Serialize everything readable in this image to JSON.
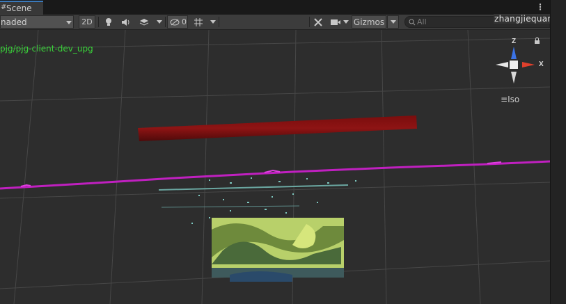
{
  "tab": {
    "label": "Scene",
    "icon": "scene-icon"
  },
  "toolbar": {
    "shading_mode": "naded",
    "mode_2d": "2D",
    "hidden_count": "0",
    "gizmos_label": "Gizmos",
    "search_placeholder": "All"
  },
  "user": {
    "name": "zhangjiequan"
  },
  "scene": {
    "overlay_path": "pjg/pjg-client-dev_upg",
    "projection_label": "Iso",
    "gizmo_axes": {
      "z": "Z",
      "x": "X"
    }
  },
  "colors": {
    "accent": "#3a79bb",
    "path_text": "#39d339",
    "gizmo_x": "#e0402c",
    "gizmo_z": "#3b73e6"
  }
}
